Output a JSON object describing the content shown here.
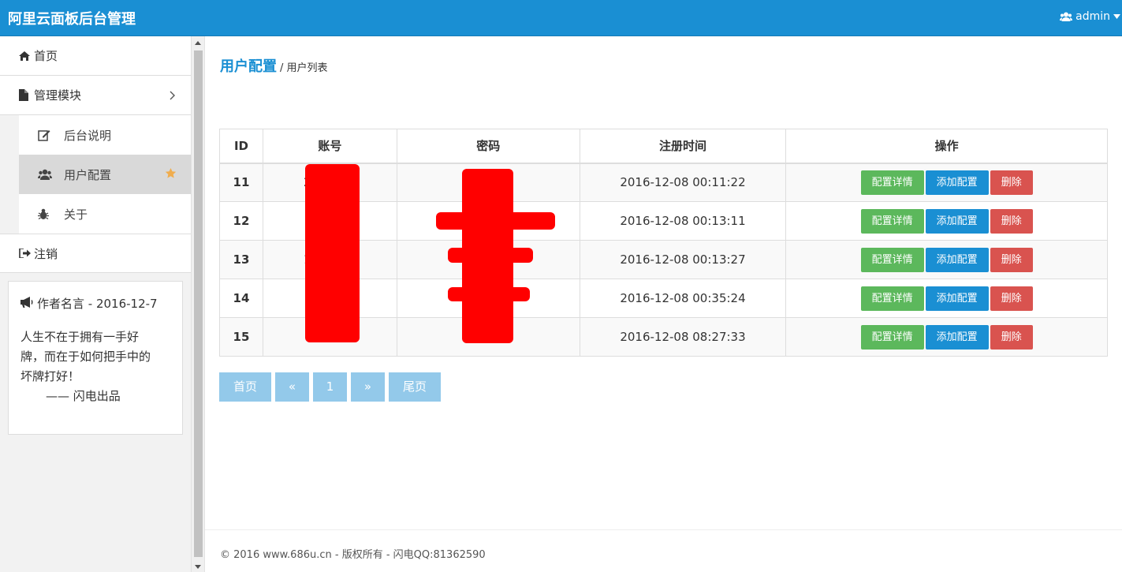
{
  "header": {
    "title": "阿里云面板后台管理",
    "user": "admin"
  },
  "sidebar": {
    "home": "首页",
    "modules": "管理模块",
    "sub_items": [
      {
        "label": "后台说明",
        "icon": "edit-icon"
      },
      {
        "label": "用户配置",
        "icon": "users-icon",
        "active": true
      },
      {
        "label": "关于",
        "icon": "bug-icon"
      }
    ],
    "logout": "注销",
    "quote": {
      "title": "作者名言 - 2016-12-7",
      "lines": [
        "人生不在于拥有一手好",
        "牌，而在于如何把手中的",
        "坏牌打好！"
      ],
      "sign": "—— 闪电出品"
    }
  },
  "breadcrumb": {
    "title": "用户配置",
    "sub": "/ 用户列表"
  },
  "table": {
    "headers": [
      "ID",
      "账号",
      "密码",
      "注册时间",
      "操作"
    ],
    "rows": [
      {
        "id": "11",
        "account": "24        3",
        "time": "2016-12-08 00:11:22"
      },
      {
        "id": "12",
        "account": "",
        "time": "2016-12-08 00:13:11"
      },
      {
        "id": "13",
        "account": "13        3",
        "time": "2016-12-08 00:13:27"
      },
      {
        "id": "14",
        "account": "2",
        "time": "2016-12-08 00:35:24"
      },
      {
        "id": "15",
        "account": "",
        "time": "2016-12-08 08:27:33"
      }
    ],
    "actions": {
      "detail": "配置详情",
      "add": "添加配置",
      "delete": "删除"
    }
  },
  "pager": {
    "first": "首页",
    "prev": "«",
    "page": "1",
    "next": "»",
    "last": "尾页"
  },
  "footer": "© 2016 www.686u.cn - 版权所有 - 闪电QQ:81362590",
  "colors": {
    "primary": "#1a8fd3",
    "success": "#5cb85c",
    "danger": "#d9534f",
    "pager": "#93c9ea",
    "redaction": "#ff0000"
  }
}
